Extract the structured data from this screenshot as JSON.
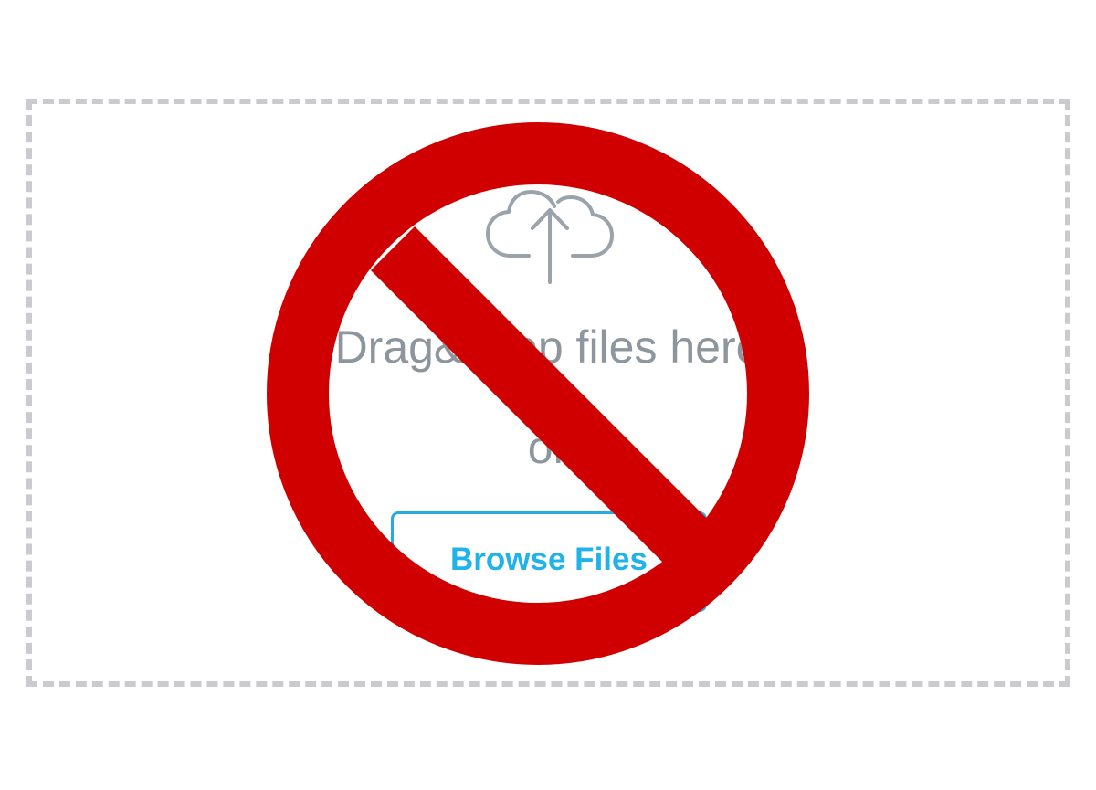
{
  "dropzone": {
    "instruction_text": "Drag&Drop files here",
    "or_text": "or",
    "browse_label": "Browse Files",
    "upload_icon": "cloud-upload-icon"
  },
  "overlay": {
    "icon": "prohibition-icon",
    "color": "#d10000"
  },
  "colors": {
    "border": "#c9cbce",
    "text": "#8d959d",
    "accent": "#1fb3ea"
  }
}
